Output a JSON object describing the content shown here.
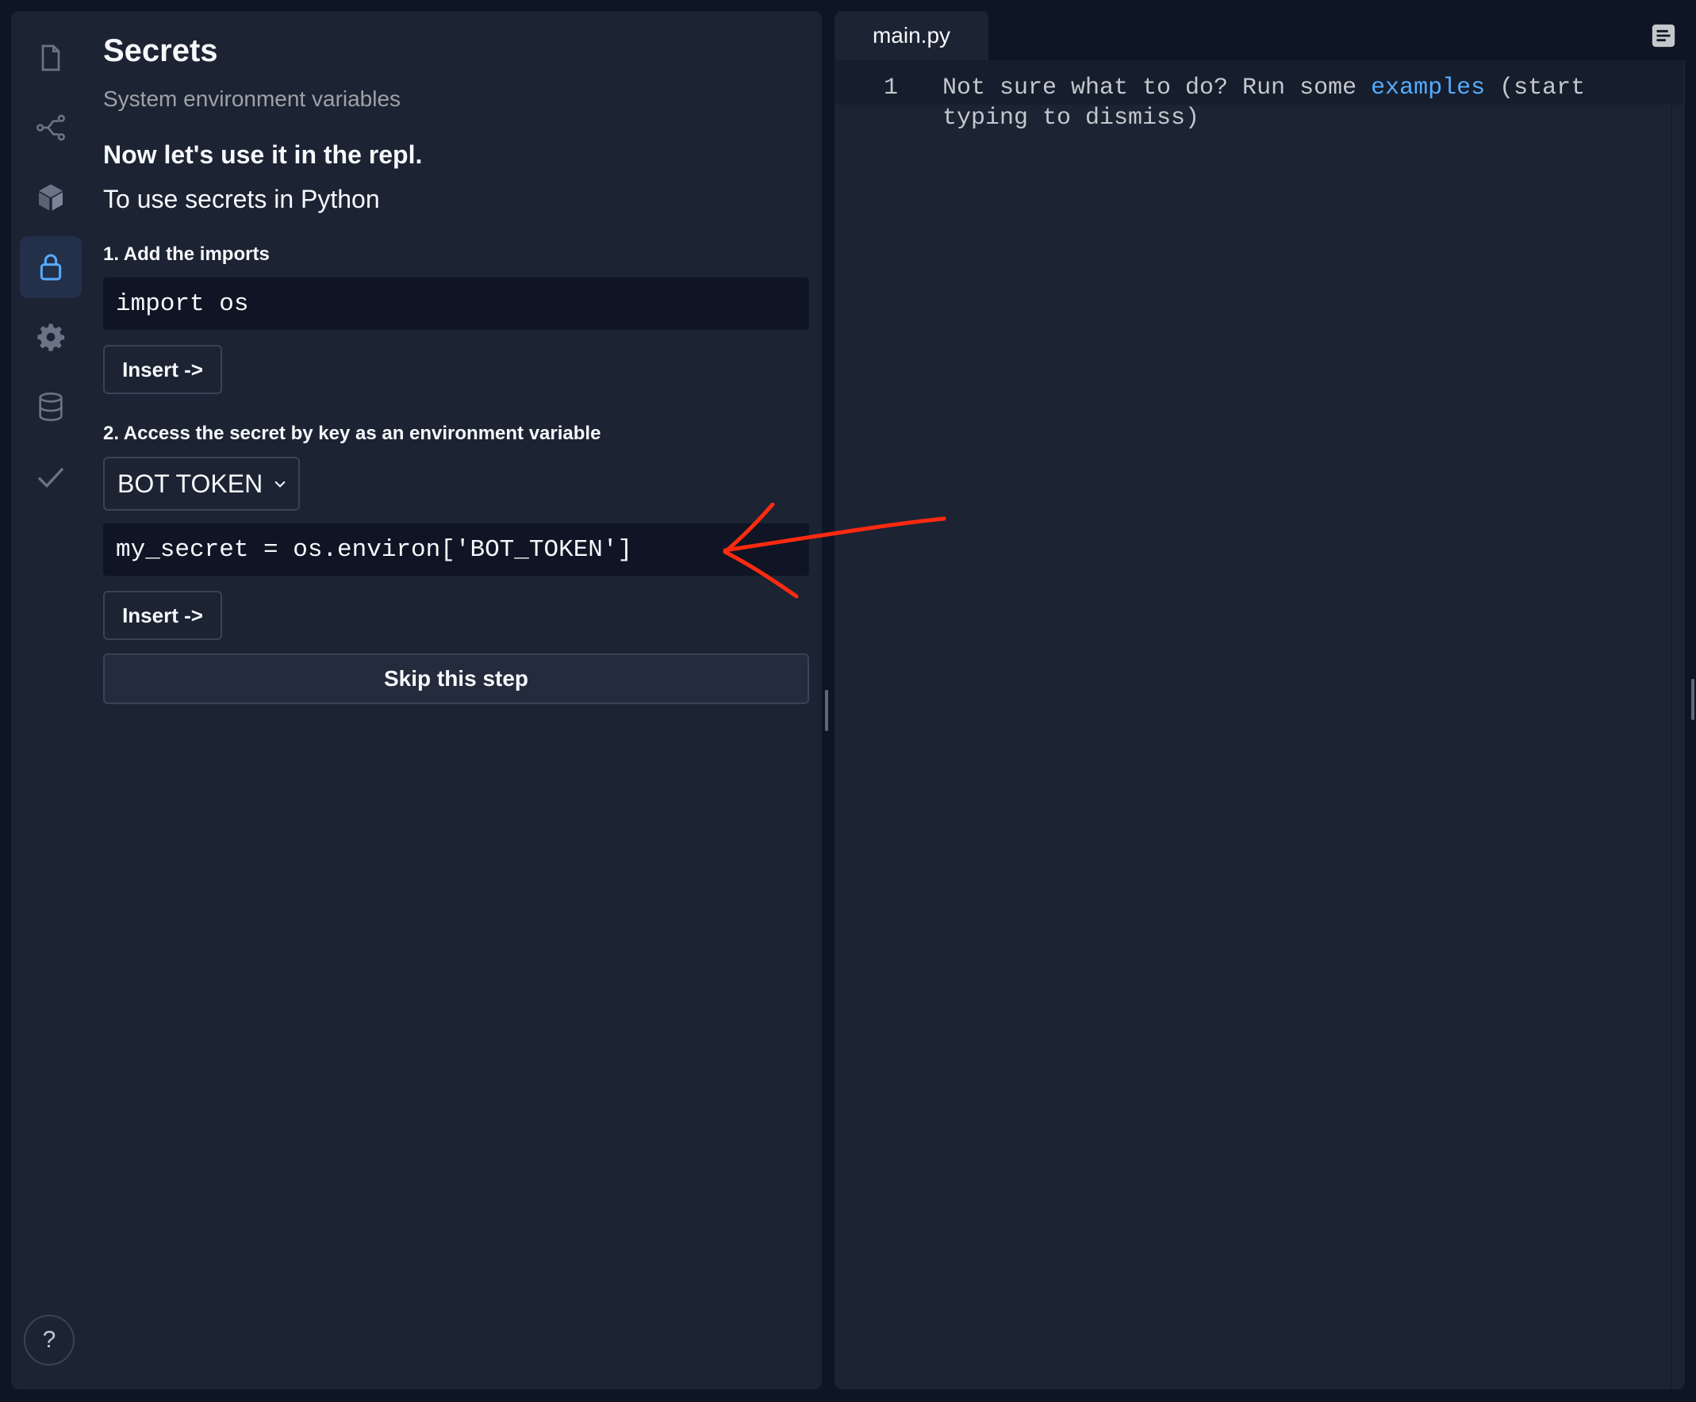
{
  "sidebar": {
    "title": "Secrets",
    "subtitle": "System environment variables",
    "heading": "Now let's use it in the repl.",
    "lead": "To use secrets in Python",
    "step1_label": "1. Add the imports",
    "import_code": "import os",
    "insert_label": "Insert ->",
    "step2_label": "2. Access the secret by key as an environment variable",
    "selected_key": "BOT TOKEN",
    "secret_code": "my_secret = os.environ['BOT_TOKEN']",
    "skip_label": "Skip this step",
    "help_label": "?",
    "rail_icons": [
      "file-icon",
      "share-icon",
      "package-icon",
      "lock-icon",
      "gear-icon",
      "database-icon",
      "check-icon"
    ]
  },
  "editor": {
    "tab_label": "main.py",
    "line_number": "1",
    "placeholder_before": "Not sure what to do? Run some ",
    "placeholder_link": "examples",
    "placeholder_after": " (start typing to dismiss)"
  },
  "colors": {
    "accent": "#57abff",
    "annotation": "#ff2a10",
    "panel": "#1c2333",
    "background": "#0e1525"
  }
}
